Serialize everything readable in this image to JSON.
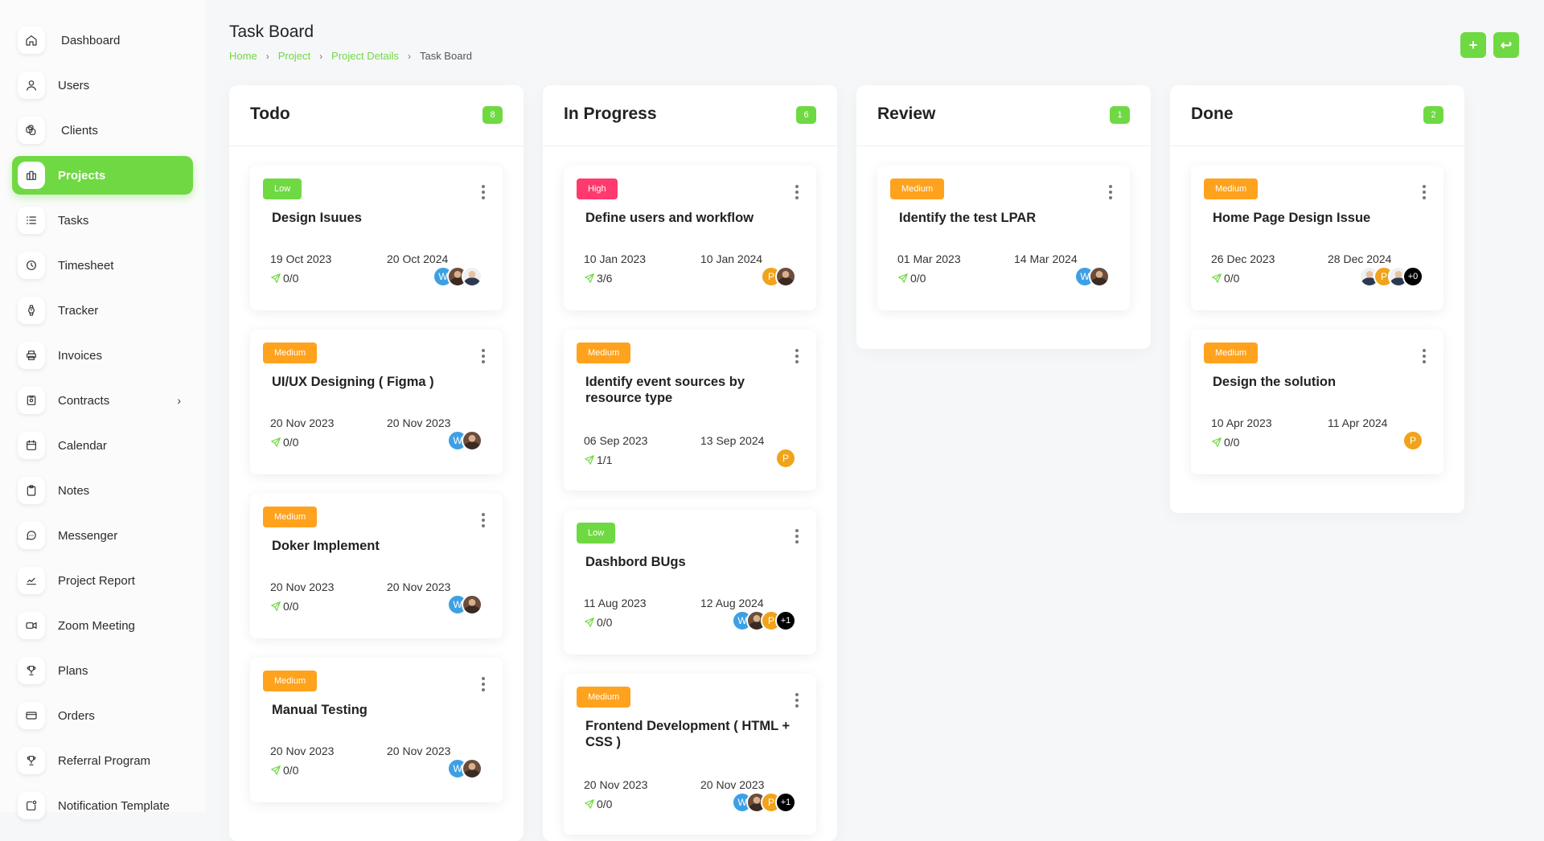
{
  "sidebar": {
    "items": [
      {
        "label": "Dashboard",
        "icon": "home-icon"
      },
      {
        "label": "Users",
        "icon": "user-icon"
      },
      {
        "label": "Clients",
        "icon": "clients-icon"
      },
      {
        "label": "Projects",
        "icon": "projects-icon",
        "active": true
      },
      {
        "label": "Tasks",
        "icon": "list-icon"
      },
      {
        "label": "Timesheet",
        "icon": "clock-icon"
      },
      {
        "label": "Tracker",
        "icon": "watch-icon"
      },
      {
        "label": "Invoices",
        "icon": "printer-icon"
      },
      {
        "label": "Contracts",
        "icon": "contract-icon",
        "has_submenu": true
      },
      {
        "label": "Calendar",
        "icon": "calendar-icon"
      },
      {
        "label": "Notes",
        "icon": "clipboard-icon"
      },
      {
        "label": "Messenger",
        "icon": "message-icon"
      },
      {
        "label": "Project Report",
        "icon": "chart-line-icon"
      },
      {
        "label": "Zoom Meeting",
        "icon": "video-icon"
      },
      {
        "label": "Plans",
        "icon": "trophy-icon"
      },
      {
        "label": "Orders",
        "icon": "credit-card-icon"
      },
      {
        "label": "Referral Program",
        "icon": "trophy-icon"
      },
      {
        "label": "Notification Template",
        "icon": "notification-icon"
      }
    ],
    "chevron": "›"
  },
  "header": {
    "title": "Task Board",
    "breadcrumb": [
      "Home",
      "Project",
      "Project Details",
      "Task Board"
    ],
    "separator": "›",
    "add_label": "+",
    "back_label": "↩"
  },
  "colors": {
    "accent": "#6fd943",
    "low": "#6fd943",
    "medium": "#ffa21d",
    "high": "#ff3a6e"
  },
  "columns": [
    {
      "title": "Todo",
      "count": "8",
      "cards": [
        {
          "priority": "Low",
          "title": "Design Isuues",
          "start": "19 Oct 2023",
          "end": "20 Oct 2024",
          "progress": "0/0",
          "avatars": [
            "W",
            "",
            ""
          ]
        },
        {
          "priority": "Medium",
          "title": "UI/UX Designing ( Figma )",
          "start": "20 Nov 2023",
          "end": "20 Nov 2023",
          "progress": "0/0",
          "avatars": [
            "W",
            ""
          ]
        },
        {
          "priority": "Medium",
          "title": "Doker Implement",
          "start": "20 Nov 2023",
          "end": "20 Nov 2023",
          "progress": "0/0",
          "avatars": [
            "W",
            ""
          ]
        },
        {
          "priority": "Medium",
          "title": "Manual Testing",
          "start": "20 Nov 2023",
          "end": "20 Nov 2023",
          "progress": "0/0",
          "avatars": [
            "W",
            ""
          ]
        }
      ]
    },
    {
      "title": "In Progress",
      "count": "6",
      "cards": [
        {
          "priority": "High",
          "title": "Define users and workflow",
          "start": "10 Jan 2023",
          "end": "10 Jan 2024",
          "progress": "3/6",
          "avatars": [
            "P",
            ""
          ]
        },
        {
          "priority": "Medium",
          "title": "Identify event sources by resource type",
          "start": "06 Sep 2023",
          "end": "13 Sep 2024",
          "progress": "1/1",
          "avatars": [
            "P"
          ]
        },
        {
          "priority": "Low",
          "title": "Dashbord BUgs",
          "start": "11 Aug 2023",
          "end": "12 Aug 2024",
          "progress": "0/0",
          "avatars": [
            "W",
            "",
            "P",
            "+1"
          ]
        },
        {
          "priority": "Medium",
          "title": "Frontend Development ( HTML + CSS )",
          "start": "20 Nov 2023",
          "end": "20 Nov 2023",
          "progress": "0/0",
          "avatars": [
            "W",
            "",
            "P",
            "+1"
          ]
        }
      ]
    },
    {
      "title": "Review",
      "count": "1",
      "cards": [
        {
          "priority": "Medium",
          "title": "Identify the test LPAR",
          "start": "01 Mar 2023",
          "end": "14 Mar 2024",
          "progress": "0/0",
          "avatars": [
            "W",
            ""
          ]
        }
      ]
    },
    {
      "title": "Done",
      "count": "2",
      "cards": [
        {
          "priority": "Medium",
          "title": "Home Page Design Issue",
          "start": "26 Dec 2023",
          "end": "28 Dec 2024",
          "progress": "0/0",
          "avatars": [
            "",
            "P",
            "",
            "+0"
          ]
        },
        {
          "priority": "Medium",
          "title": "Design the solution",
          "start": "10 Apr 2023",
          "end": "11 Apr 2024",
          "progress": "0/0",
          "avatars": [
            "P"
          ]
        }
      ]
    }
  ]
}
